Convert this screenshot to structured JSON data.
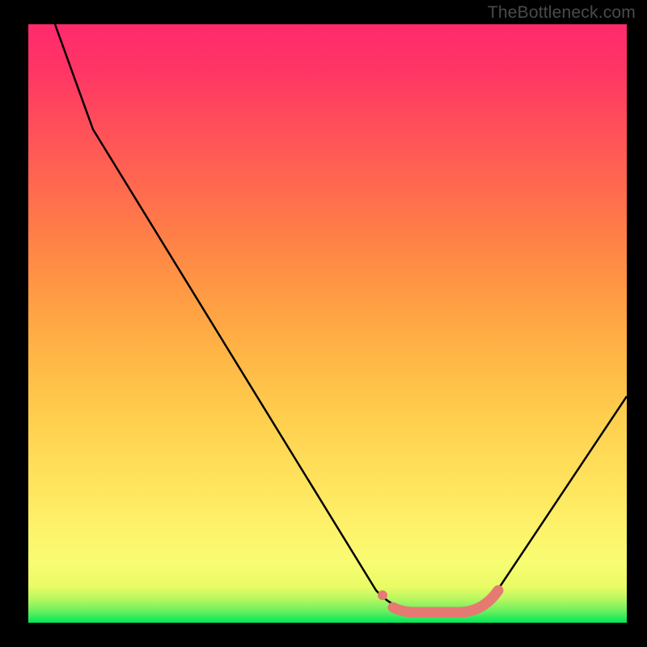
{
  "watermark": "TheBottleneck.com",
  "colors": {
    "background": "#000000",
    "gradient_top": "#ff2a6d",
    "gradient_mid": "#ffe25c",
    "gradient_bottom": "#00e756",
    "curve": "#000000",
    "markers": "#e47a72"
  },
  "chart_data": {
    "type": "line",
    "title": "",
    "xlabel": "",
    "ylabel": "",
    "xlim": [
      0,
      100
    ],
    "ylim": [
      0,
      100
    ],
    "series": [
      {
        "name": "bottleneck-curve",
        "x": [
          4,
          10,
          20,
          30,
          40,
          50,
          58,
          62,
          66,
          70,
          74,
          78,
          82,
          90,
          100
        ],
        "y": [
          100,
          85,
          68,
          52,
          36,
          20,
          6,
          2,
          1,
          1,
          1,
          3,
          8,
          22,
          38
        ]
      }
    ],
    "annotations": [
      {
        "name": "valley-flat-region",
        "x_range": [
          62,
          78
        ],
        "y": 1
      }
    ],
    "background_gradient": {
      "direction": "vertical",
      "stops": [
        {
          "pos": 0.0,
          "color": "#00e756"
        },
        {
          "pos": 0.06,
          "color": "#e9fb65"
        },
        {
          "pos": 0.24,
          "color": "#ffe25c"
        },
        {
          "pos": 0.54,
          "color": "#ff9d44"
        },
        {
          "pos": 0.84,
          "color": "#ff4c5b"
        },
        {
          "pos": 1.0,
          "color": "#ff2a6d"
        }
      ]
    }
  }
}
